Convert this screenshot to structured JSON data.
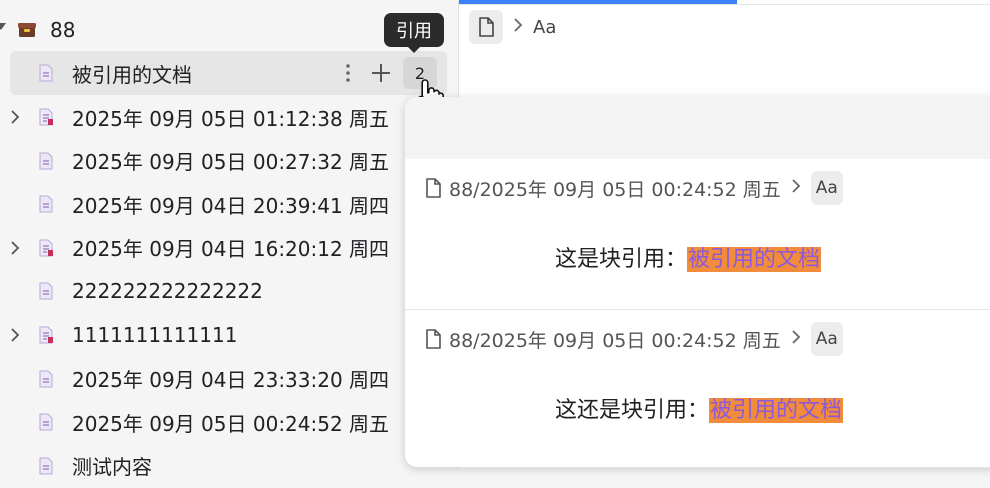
{
  "sidebar": {
    "root": {
      "label": "88"
    },
    "active_item": {
      "label": "被引用的文档",
      "ref_count": "2"
    },
    "items": [
      {
        "label": "2025年 09月 05日 01:12:38 周五",
        "has_children": true
      },
      {
        "label": "2025年 09月 05日 00:27:32 周五",
        "has_children": false
      },
      {
        "label": "2025年 09月 04日 20:39:41 周四",
        "has_children": false
      },
      {
        "label": "2025年 09月 04日 16:20:12 周四",
        "has_children": true
      },
      {
        "label": "222222222222222",
        "has_children": false
      },
      {
        "label": "1111111111111",
        "has_children": true
      },
      {
        "label": "2025年 09月 04日 23:33:20 周四",
        "has_children": false
      },
      {
        "label": "2025年 09月 05日 00:24:52 周五",
        "has_children": false
      },
      {
        "label": "测试内容",
        "has_children": false
      }
    ]
  },
  "tooltip": {
    "text": "引用"
  },
  "editor": {
    "breadcrumb_aa": "Aa"
  },
  "popover": {
    "refs": [
      {
        "path": "88/2025年 09月 05日 00:24:52 周五",
        "aa": "Aa",
        "prefix": "这是块引用：",
        "link": "被引用的文档"
      },
      {
        "path": "88/2025年 09月 05日 00:24:52 周五",
        "aa": "Aa",
        "prefix": "这还是块引用：",
        "link": "被引用的文档"
      }
    ]
  },
  "colors": {
    "accent": "#3b82f6",
    "highlight_bg": "#f08c3c",
    "link_text": "#8f59d8"
  }
}
